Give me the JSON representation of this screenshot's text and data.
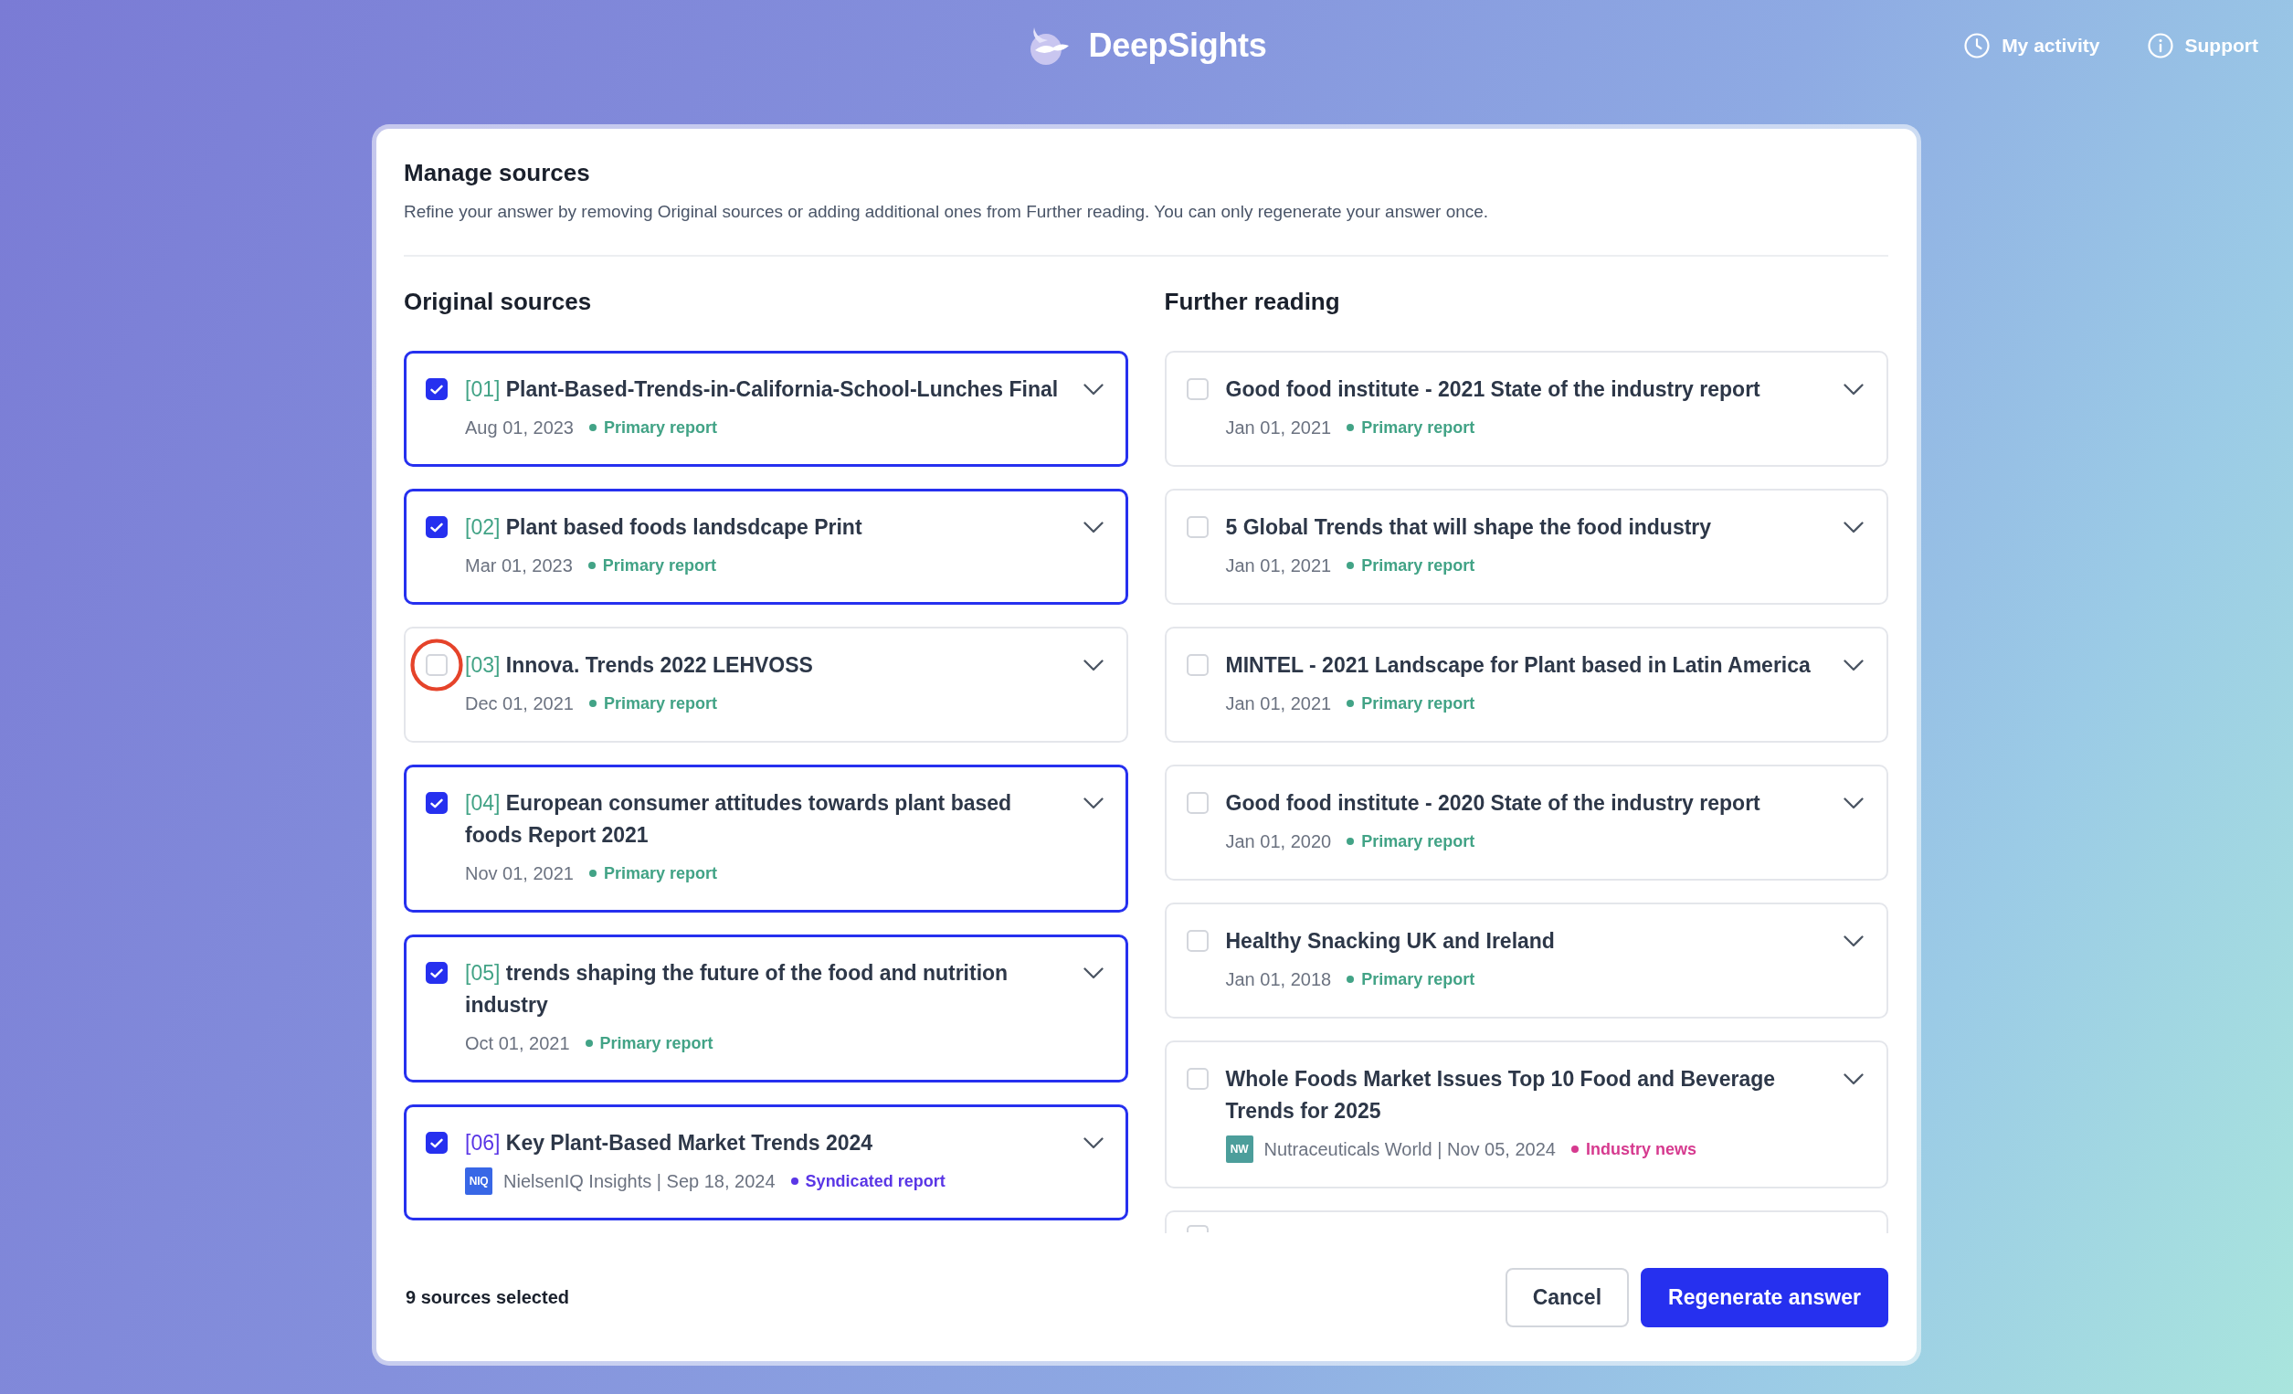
{
  "header": {
    "logo": "DeepSights",
    "nav": [
      {
        "label": "My activity"
      },
      {
        "label": "Support"
      }
    ]
  },
  "dialog": {
    "title": "Manage sources",
    "description": "Refine your answer by removing Original sources or adding additional ones from Further reading. You can only regenerate your answer once.",
    "original_sources": {
      "heading": "Original sources",
      "items": [
        {
          "index": "[01]",
          "title": "Plant-Based-Trends-in-California-School-Lunches Final",
          "checked": true,
          "circled": false,
          "date": "Aug 01, 2023",
          "tag": {
            "label": "Primary report",
            "color": "#42a386"
          }
        },
        {
          "index": "[02]",
          "title": "Plant based foods landsdcape Print",
          "checked": true,
          "circled": false,
          "date": "Mar 01, 2023",
          "tag": {
            "label": "Primary report",
            "color": "#42a386"
          }
        },
        {
          "index": "[03]",
          "title": "Innova. Trends 2022 LEHVOSS",
          "checked": false,
          "circled": true,
          "date": "Dec 01, 2021",
          "tag": {
            "label": "Primary report",
            "color": "#42a386"
          }
        },
        {
          "index": "[04]",
          "title": "European consumer attitudes towards plant based foods Report 2021",
          "checked": true,
          "circled": false,
          "date": "Nov 01, 2021",
          "tag": {
            "label": "Primary report",
            "color": "#42a386"
          }
        },
        {
          "index": "[05]",
          "title": "trends shaping the future of the food and nutrition industry",
          "checked": true,
          "circled": false,
          "date": "Oct 01, 2021",
          "tag": {
            "label": "Primary report",
            "color": "#42a386"
          }
        },
        {
          "index": "[06]",
          "title": "Key Plant-Based Market Trends 2024",
          "checked": true,
          "circled": false,
          "source": {
            "logo": "NIQ",
            "color": "#3867e6",
            "text": "NielsenIQ Insights | Sep 18, 2024"
          },
          "tag": {
            "label": "Syndicated report",
            "color": "#5a36e6"
          }
        }
      ]
    },
    "further_reading": {
      "heading": "Further reading",
      "items": [
        {
          "title": "Good food institute - 2021 State of the industry report",
          "checked": false,
          "circled": false,
          "date": "Jan 01, 2021",
          "tag": {
            "label": "Primary report",
            "color": "#42a386"
          }
        },
        {
          "title": "5 Global Trends that will shape the food industry",
          "checked": false,
          "circled": false,
          "date": "Jan 01, 2021",
          "tag": {
            "label": "Primary report",
            "color": "#42a386"
          }
        },
        {
          "title": "MINTEL - 2021 Landscape for Plant based in Latin America",
          "checked": false,
          "circled": false,
          "date": "Jan 01, 2021",
          "tag": {
            "label": "Primary report",
            "color": "#42a386"
          }
        },
        {
          "title": "Good food institute - 2020 State of the industry report",
          "checked": false,
          "circled": false,
          "date": "Jan 01, 2020",
          "tag": {
            "label": "Primary report",
            "color": "#42a386"
          }
        },
        {
          "title": "Healthy Snacking UK and Ireland",
          "checked": false,
          "circled": false,
          "date": "Jan 01, 2018",
          "tag": {
            "label": "Primary report",
            "color": "#42a386"
          }
        },
        {
          "title": "Whole Foods Market Issues Top 10 Food and Beverage Trends for 2025",
          "checked": false,
          "circled": false,
          "source": {
            "logo": "NW",
            "color": "#4c9e9b",
            "text": "Nutraceuticals World | Nov 05, 2024"
          },
          "tag": {
            "label": "Industry news",
            "color": "#d63a8f"
          }
        }
      ],
      "cut_off_item": {
        "checked": false
      }
    },
    "footer": {
      "selected_count": "9 sources selected",
      "buttons": [
        {
          "label": "Cancel",
          "kind": "secondary"
        },
        {
          "label": "Regenerate answer",
          "kind": "primary"
        }
      ]
    }
  }
}
